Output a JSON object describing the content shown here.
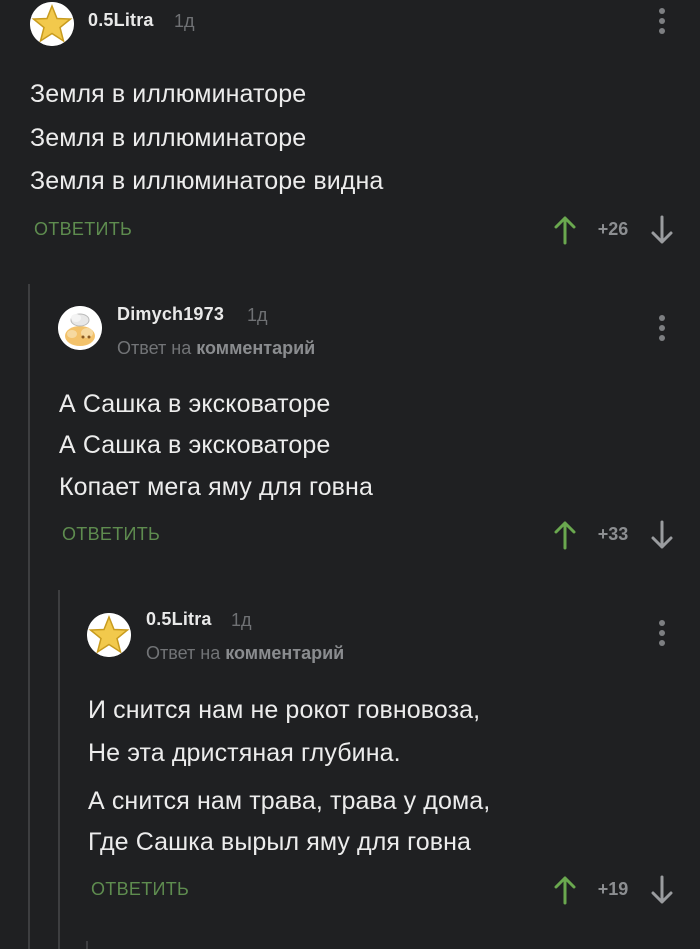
{
  "comments": [
    {
      "username": "0.5Litra",
      "time": "1д",
      "avatar": "star-icon",
      "reply_prefix": "",
      "reply_target": "",
      "lines": [
        "Земля в иллюминаторе",
        "Земля в иллюминаторе",
        "Земля в иллюминаторе видна"
      ],
      "reply_label": "ОТВЕТИТЬ",
      "score": "+26"
    },
    {
      "username": "Dimych1973",
      "time": "1д",
      "avatar": "cartoon-face-icon",
      "reply_prefix": "Ответ на",
      "reply_target": "комментарий",
      "lines": [
        "А Сашка в эксковаторе",
        "А Сашка в эксковаторе",
        "Копает мега яму для говна"
      ],
      "reply_label": "ОТВЕТИТЬ",
      "score": "+33"
    },
    {
      "username": "0.5Litra",
      "time": "1д",
      "avatar": "star-icon",
      "reply_prefix": "Ответ на",
      "reply_target": "комментарий",
      "lines": [
        "И снится нам не рокот говновоза,",
        "Не эта дристяная глубина.",
        "А снится нам трава, трава у дома,",
        "Где Сашка вырыл яму для говна"
      ],
      "reply_label": "ОТВЕТИТЬ",
      "score": "+19"
    }
  ],
  "colors": {
    "background": "#1f2022",
    "reply_green": "#5e8c4f",
    "upvote_green": "#6aa84f",
    "star_gold": "#f2c94c"
  }
}
